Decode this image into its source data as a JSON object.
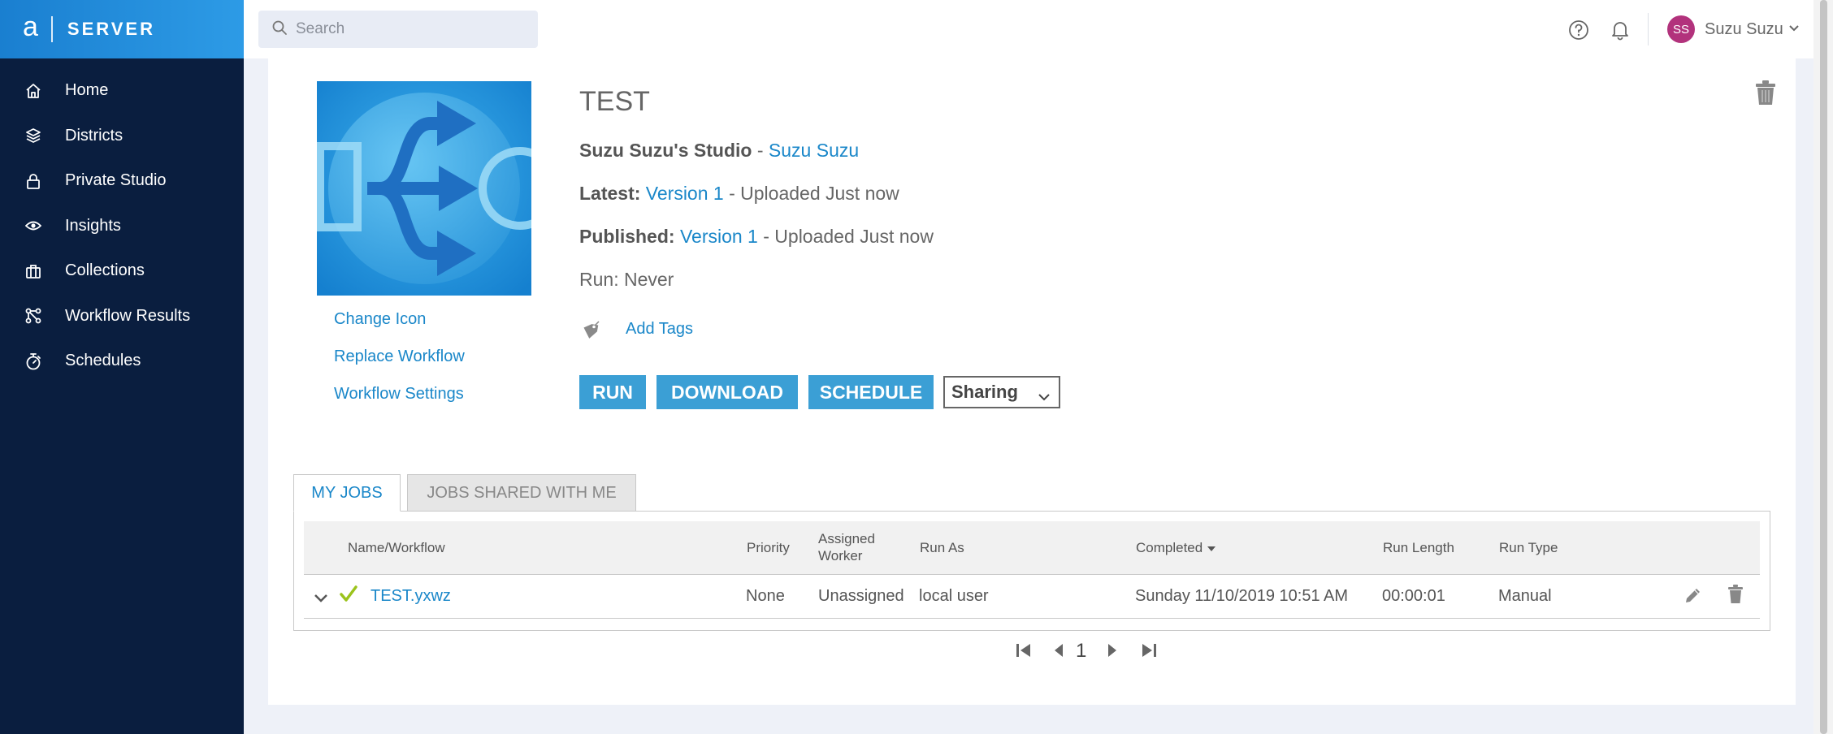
{
  "brand": {
    "logo_letter": "a",
    "name": "SERVER"
  },
  "sidebar": {
    "items": [
      {
        "label": "Home",
        "icon": "home-icon"
      },
      {
        "label": "Districts",
        "icon": "layers-icon"
      },
      {
        "label": "Private Studio",
        "icon": "lock-icon"
      },
      {
        "label": "Insights",
        "icon": "eye-icon"
      },
      {
        "label": "Collections",
        "icon": "briefcase-icon"
      },
      {
        "label": "Workflow Results",
        "icon": "workflow-icon"
      },
      {
        "label": "Schedules",
        "icon": "stopwatch-icon"
      }
    ]
  },
  "topbar": {
    "search_placeholder": "Search",
    "user_initials": "SS",
    "user_name": "Suzu Suzu"
  },
  "workflow": {
    "title": "TEST",
    "studio_name": "Suzu Suzu's Studio",
    "studio_separator": " - ",
    "owner": "Suzu Suzu",
    "latest_label": "Latest:",
    "latest_version": "Version 1",
    "latest_note": " - Uploaded Just now",
    "published_label": "Published:",
    "published_version": "Version 1",
    "published_note": " - Uploaded Just now",
    "run_status": "Run: Never",
    "add_tags": "Add Tags",
    "links": {
      "change_icon": "Change Icon",
      "replace_workflow": "Replace Workflow",
      "workflow_settings": "Workflow Settings"
    },
    "buttons": {
      "run": "RUN",
      "download": "DOWNLOAD",
      "schedule": "SCHEDULE"
    },
    "sharing": {
      "selected": "Sharing"
    }
  },
  "jobs": {
    "tabs": {
      "my_jobs": "MY JOBS",
      "shared": "JOBS SHARED WITH ME"
    },
    "columns": {
      "name": "Name/Workflow",
      "priority": "Priority",
      "worker_line1": "Assigned",
      "worker_line2": "Worker",
      "run_as": "Run As",
      "completed": "Completed",
      "run_length": "Run Length",
      "run_type": "Run Type"
    },
    "rows": [
      {
        "name": "TEST.yxwz",
        "priority": "None",
        "worker": "Unassigned",
        "run_as": "local user",
        "completed": "Sunday 11/10/2019 10:51 AM",
        "run_length": "00:00:01",
        "run_type": "Manual"
      }
    ],
    "pagination": {
      "current": "1"
    }
  },
  "colors": {
    "sidebar_bg": "#0a1e3f",
    "brand_gradient_start": "#1a7fd0",
    "accent_link": "#1a87c9",
    "button_bg": "#3b9fd5",
    "success_check": "#9bc31c",
    "avatar_bg": "#b2327c"
  }
}
